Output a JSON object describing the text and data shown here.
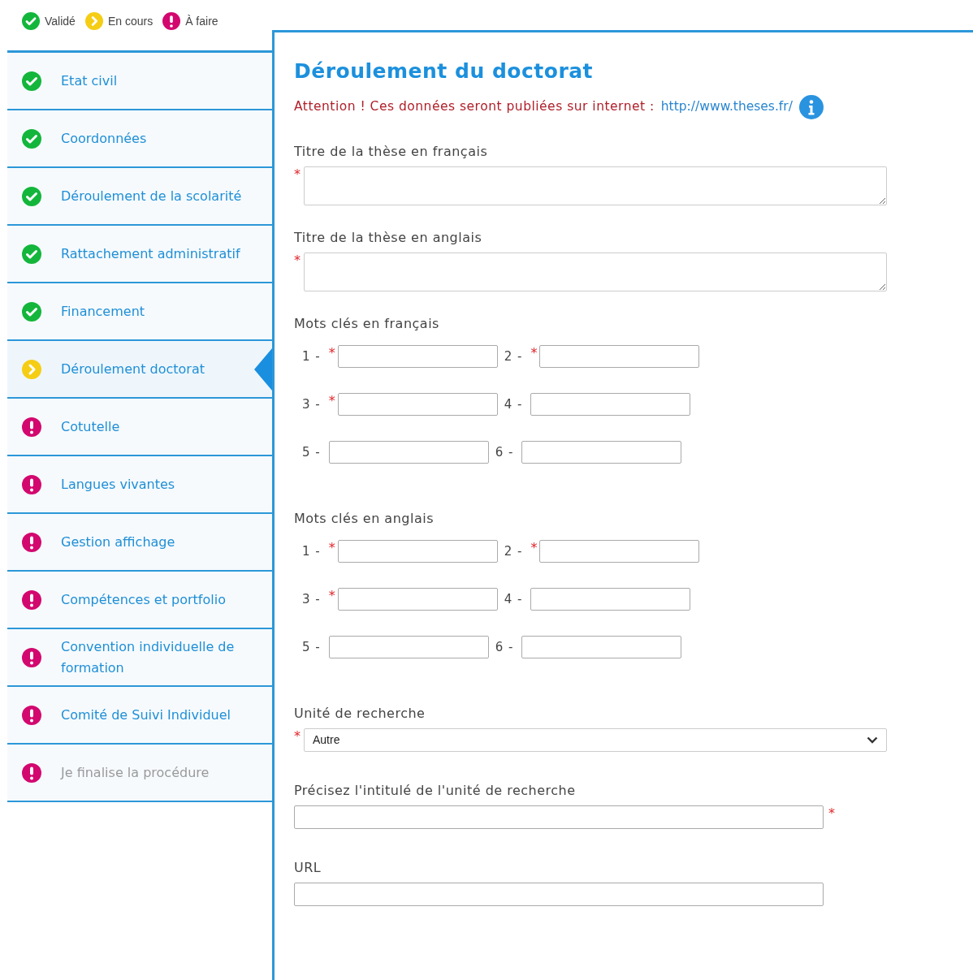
{
  "legend": [
    {
      "kind": "done",
      "label": "Validé"
    },
    {
      "kind": "current",
      "label": "En cours"
    },
    {
      "kind": "todo",
      "label": "À faire"
    }
  ],
  "sidebar": {
    "items": [
      {
        "label": "Etat civil",
        "kind": "done",
        "selected": false,
        "disabled": false
      },
      {
        "label": "Coordonnées",
        "kind": "done",
        "selected": false,
        "disabled": false
      },
      {
        "label": "Déroulement de la scolarité",
        "kind": "done",
        "selected": false,
        "disabled": false
      },
      {
        "label": "Rattachement administratif",
        "kind": "done",
        "selected": false,
        "disabled": false
      },
      {
        "label": "Financement",
        "kind": "done",
        "selected": false,
        "disabled": false
      },
      {
        "label": "Déroulement doctorat",
        "kind": "current",
        "selected": true,
        "disabled": false
      },
      {
        "label": "Cotutelle",
        "kind": "todo",
        "selected": false,
        "disabled": false
      },
      {
        "label": "Langues vivantes",
        "kind": "todo",
        "selected": false,
        "disabled": false
      },
      {
        "label": "Gestion affichage",
        "kind": "todo",
        "selected": false,
        "disabled": false
      },
      {
        "label": "Compétences et portfolio",
        "kind": "todo",
        "selected": false,
        "disabled": false
      },
      {
        "label": "Convention individuelle de formation",
        "kind": "todo",
        "selected": false,
        "disabled": false
      },
      {
        "label": "Comité de Suivi Individuel",
        "kind": "todo",
        "selected": false,
        "disabled": false
      },
      {
        "label": "Je finalise la procédure",
        "kind": "todo",
        "selected": false,
        "disabled": true
      }
    ]
  },
  "form": {
    "title": "Déroulement du doctorat",
    "notice": {
      "text": "Attention ! Ces données seront publiées sur internet :",
      "link": "http://www.theses.fr/"
    },
    "required_mark": "*",
    "sections": [
      {
        "kind": "textarea",
        "label": "Titre de la thèse en français",
        "required": true
      },
      {
        "kind": "textarea",
        "label": "Titre de la thèse en anglais",
        "required": true
      },
      {
        "kind": "keywords",
        "label": "Mots clés en français",
        "rows": [
          [
            {
              "label": "1 -",
              "required": true
            },
            {
              "label": "2 -",
              "required": true
            }
          ],
          [
            {
              "label": "3 -",
              "required": true
            },
            {
              "label": "4 -",
              "required": false
            }
          ],
          [
            {
              "label": "5 -",
              "required": false
            },
            {
              "label": "6 -",
              "required": false
            }
          ]
        ]
      },
      {
        "kind": "keywords",
        "label": "Mots clés en anglais",
        "rows": [
          [
            {
              "label": "1 -",
              "required": true
            },
            {
              "label": "2 -",
              "required": true
            }
          ],
          [
            {
              "label": "3 -",
              "required": true
            },
            {
              "label": "4 -",
              "required": false
            }
          ],
          [
            {
              "label": "5 -",
              "required": false
            },
            {
              "label": "6 -",
              "required": false
            }
          ]
        ]
      },
      {
        "kind": "select",
        "label": "Unité de recherche",
        "required": true,
        "value": "Autre"
      },
      {
        "kind": "input",
        "label": "Précisez l'intitulé de l'unité de recherche",
        "required": true
      },
      {
        "kind": "input",
        "label": "URL",
        "required": false
      }
    ]
  }
}
